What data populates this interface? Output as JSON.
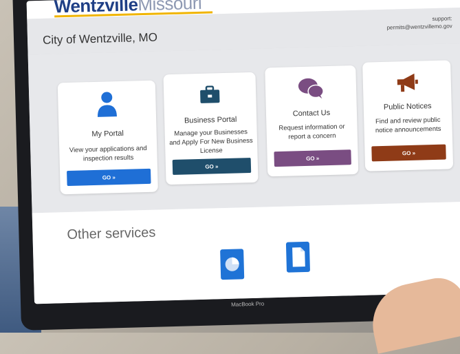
{
  "brand": {
    "name_bold": "Wentzville",
    "name_light": "Missouri"
  },
  "header": {
    "city_title": "City of Wentzville, MO",
    "support_label": "support:",
    "support_email": "permits@wentzvillemo.gov"
  },
  "cards": [
    {
      "title": "My Portal",
      "desc": "View your applications and inspection results",
      "go": "GO »",
      "color": "#1f6fd6",
      "icon": "person-icon"
    },
    {
      "title": "Business Portal",
      "desc": "Manage your Businesses and Apply For New Business License",
      "go": "GO »",
      "color": "#1f4e6b",
      "icon": "briefcase-icon"
    },
    {
      "title": "Contact Us",
      "desc": "Request information or report a concern",
      "go": "GO »",
      "color": "#7a4d82",
      "icon": "chat-bubbles-icon"
    },
    {
      "title": "Public Notices",
      "desc": "Find and review public notice announcements",
      "go": "GO »",
      "color": "#8f3b17",
      "icon": "megaphone-icon"
    }
  ],
  "other_services": {
    "title": "Other services"
  },
  "laptop": {
    "model": "MacBook Pro"
  }
}
